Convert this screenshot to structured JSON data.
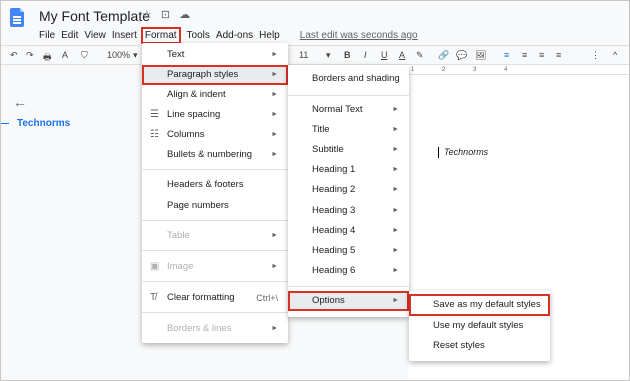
{
  "app": {
    "title": "My Font Template",
    "title_icons": "☆ ⊡ ☁",
    "last_edit": "Last edit was seconds ago"
  },
  "menubar": {
    "file": "File",
    "edit": "Edit",
    "view": "View",
    "insert": "Insert",
    "format": "Format",
    "tools": "Tools",
    "addons": "Add-ons",
    "help": "Help"
  },
  "toolbar": {
    "undo": "↶",
    "redo": "↷",
    "print": "🖶",
    "paint": "⛉",
    "zoom": "100%",
    "zoom_caret": "▾",
    "font_size": "11",
    "font_size_caret": "▾",
    "bold": "B",
    "italic": "I",
    "underline": "U",
    "text_color": "A",
    "highlight": "✎",
    "link": "🔗",
    "comment": "💬",
    "image": "🖼",
    "align_left": "≡",
    "align_center": "≡",
    "align_right": "≡",
    "justify": "≡",
    "more": "⋮",
    "collapse": "^"
  },
  "ruler": "1 2 3 4",
  "outline": {
    "back": "←",
    "item": "Technorms"
  },
  "document": {
    "text": "Technorms"
  },
  "format_menu": {
    "items": [
      {
        "label": "Text",
        "arrow": "►"
      },
      {
        "label": "Paragraph styles",
        "arrow": "►"
      },
      {
        "label": "Align & indent",
        "arrow": "►"
      },
      {
        "label": "Line spacing",
        "arrow": "►",
        "icon": "☰"
      },
      {
        "label": "Columns",
        "arrow": "►",
        "icon": "☷"
      },
      {
        "label": "Bullets & numbering",
        "arrow": "►"
      },
      {
        "label": "Headers & footers"
      },
      {
        "label": "Page numbers"
      },
      {
        "label": "Table",
        "arrow": "►"
      },
      {
        "label": "Image",
        "arrow": "►",
        "icon": "▣"
      },
      {
        "label": "Clear formatting",
        "shortcut": "Ctrl+\\",
        "icon": "T̸"
      },
      {
        "label": "Borders & lines",
        "arrow": "►"
      }
    ]
  },
  "paragraph_menu": {
    "items": [
      {
        "label": "Borders and shading"
      },
      {
        "label": "Normal Text",
        "arrow": "►"
      },
      {
        "label": "Title",
        "arrow": "►"
      },
      {
        "label": "Subtitle",
        "arrow": "►"
      },
      {
        "label": "Heading 1",
        "arrow": "►"
      },
      {
        "label": "Heading 2",
        "arrow": "►"
      },
      {
        "label": "Heading 3",
        "arrow": "►"
      },
      {
        "label": "Heading 4",
        "arrow": "►"
      },
      {
        "label": "Heading 5",
        "arrow": "►"
      },
      {
        "label": "Heading 6",
        "arrow": "►"
      },
      {
        "label": "Options",
        "arrow": "►"
      }
    ]
  },
  "options_menu": {
    "items": [
      {
        "label": "Save as my default styles"
      },
      {
        "label": "Use my default styles"
      },
      {
        "label": "Reset styles"
      }
    ]
  },
  "colors": {
    "highlight_box": "#d93025",
    "accent": "#1a73e8",
    "doc_icon": "#4285f4"
  }
}
